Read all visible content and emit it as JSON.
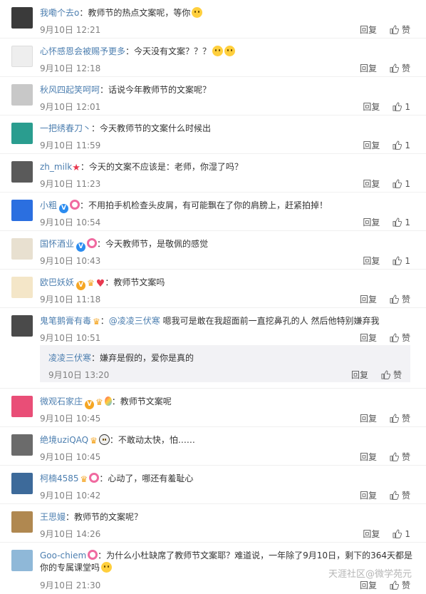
{
  "comments": [
    {
      "user": "我嘞个去o",
      "text": "：教师节的热点文案呢，等你",
      "time": "9月10日 12:21",
      "reply": "回复",
      "like": "赞",
      "avatar": "#3a3a3a"
    },
    {
      "user": "心怀感恩会被赐予更多",
      "text": "：今天没有文案？？？",
      "time": "9月10日 12:18",
      "reply": "回复",
      "like": "赞",
      "avatar": "#d9d9d9"
    },
    {
      "user": "秋风四起笑呵呵",
      "text": "：话说今年教师节的文案呢？",
      "time": "9月10日 12:01",
      "reply": "回复",
      "like": "1",
      "avatar": "#c0c0c0"
    },
    {
      "user": "一把绣春刀丶",
      "text": "：今天教师节的文案什么时候出",
      "time": "9月10日 11:59",
      "reply": "回复",
      "like": "1",
      "avatar": "#2a9d8f"
    },
    {
      "user": "zh_milk",
      "text": "：今天的文案不应该是：老师，你湿了吗？",
      "time": "9月10日 11:23",
      "reply": "回复",
      "like": "1",
      "avatar": "#5a5a5a"
    },
    {
      "user": "小粗",
      "text": "：不用拍手机检查头皮屑，有可能飘在了你的肩膀上，赶紧拍掉！",
      "time": "9月10日 10:54",
      "reply": "回复",
      "like": "1",
      "avatar": "#2b6fe0"
    },
    {
      "user": "国怀酒业",
      "text": "：今天教师节，是敬佩的感觉",
      "time": "9月10日 10:43",
      "reply": "回复",
      "like": "1",
      "avatar": "#e8e0d0"
    },
    {
      "user": "欧巴妖妖",
      "text": "：教师节文案吗",
      "time": "9月10日 11:18",
      "reply": "回复",
      "like": "赞",
      "avatar": "#f4e6c8"
    },
    {
      "user": "鬼笔鹅膏有毒",
      "mention": "@凌凌三伏寒",
      "text": " 嗯我可是敢在我超面前一直挖鼻孔的人 然后他特别嫌弃我",
      "time": "9月10日 10:51",
      "reply": "回复",
      "like": "赞",
      "avatar": "#4a4a4a"
    },
    {
      "user": "微观石家庄",
      "text": "：教师节文案呢",
      "time": "9月10日 10:45",
      "reply": "回复",
      "like": "赞",
      "avatar": "#e94e77"
    },
    {
      "user": "绝境uziQAQ",
      "text": "：不敢动太快，怕……",
      "time": "9月10日 10:45",
      "reply": "回复",
      "like": "赞",
      "avatar": "#6b6b6b"
    },
    {
      "user": "柯楠4585",
      "text": "：心动了，哪还有羞耻心",
      "time": "9月10日 10:42",
      "reply": "回复",
      "like": "赞",
      "avatar": "#3d6a9a"
    },
    {
      "user": "王思嫚",
      "text": "：教师节的文案呢？",
      "time": "9月10日 14:26",
      "reply": "回复",
      "like": "1",
      "avatar": "#b08850"
    },
    {
      "user": "Goo-chiem",
      "text": "：为什么小杜缺席了教师节文案耶？难道说，一年除了9月10日，剩下的364天都是你的专属课堂吗",
      "time": "9月10日 21:30",
      "reply": "回复",
      "like": "赞",
      "avatar": "#8fb8d8"
    }
  ],
  "subreply": {
    "user": "凌凌三伏寒",
    "text": "：嫌弃是假的，爱你是真的",
    "time": "9月10日 13:20",
    "reply": "回复",
    "like": "赞"
  },
  "watermark": "天涯社区@微学苑元"
}
